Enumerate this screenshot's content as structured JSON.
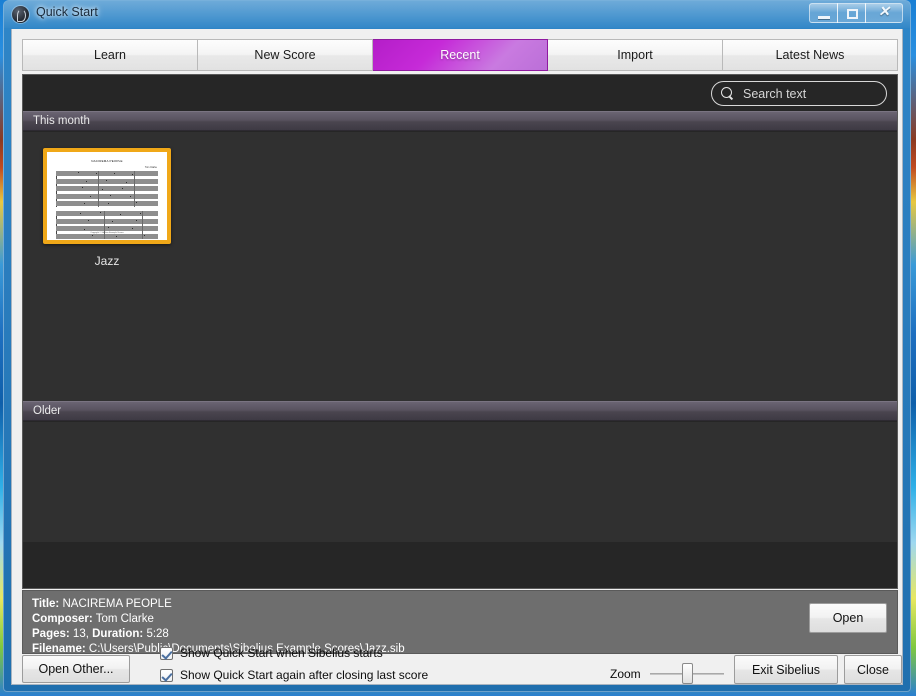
{
  "window": {
    "title": "Quick Start",
    "icon": "sibelius-logo-icon",
    "controls": {
      "minimize": "minimize-icon",
      "maximize": "maximize-icon",
      "close": "✕"
    }
  },
  "tabs": [
    {
      "label": "Learn",
      "active": false
    },
    {
      "label": "New Score",
      "active": false
    },
    {
      "label": "Recent",
      "active": true
    },
    {
      "label": "Import",
      "active": false
    },
    {
      "label": "Latest News",
      "active": false
    }
  ],
  "search": {
    "placeholder": "Search text",
    "value": "",
    "icon": "search-icon"
  },
  "sections": [
    {
      "id": "this-month",
      "title": "This month"
    },
    {
      "id": "older",
      "title": "Older"
    }
  ],
  "scores": [
    {
      "label": "Jazz",
      "selected": true,
      "thumbnail": {
        "score_title": "NACIREMA PEOPLE",
        "score_composer": "Tom Clarke",
        "footer": "Copyright © Sibelius Example Scores"
      }
    }
  ],
  "metadata": {
    "title_label": "Title:",
    "title_value": "NACIREMA PEOPLE",
    "composer_label": "Composer:",
    "composer_value": "Tom Clarke",
    "pages_label": "Pages:",
    "pages_value": "13,",
    "duration_label": "Duration:",
    "duration_value": "5:28",
    "filename_label": "Filename:",
    "filename_value": "C:\\Users\\Public\\Documents\\Sibelius Example Scores\\Jazz.sib"
  },
  "buttons": {
    "open": "Open",
    "open_other": "Open Other...",
    "exit": "Exit Sibelius",
    "close": "Close"
  },
  "checkboxes": [
    {
      "label": "Show Quick Start when Sibelius starts",
      "checked": true
    },
    {
      "label": "Show Quick Start again after closing last score",
      "checked": true
    }
  ],
  "zoom": {
    "label": "Zoom",
    "value": 43
  },
  "colors": {
    "accent_tab": "#c62ad8",
    "selection": "#f0a818",
    "panel_dark": "#262626",
    "info_panel": "#6e6e6e",
    "titlebar": "#2a7dbe"
  }
}
